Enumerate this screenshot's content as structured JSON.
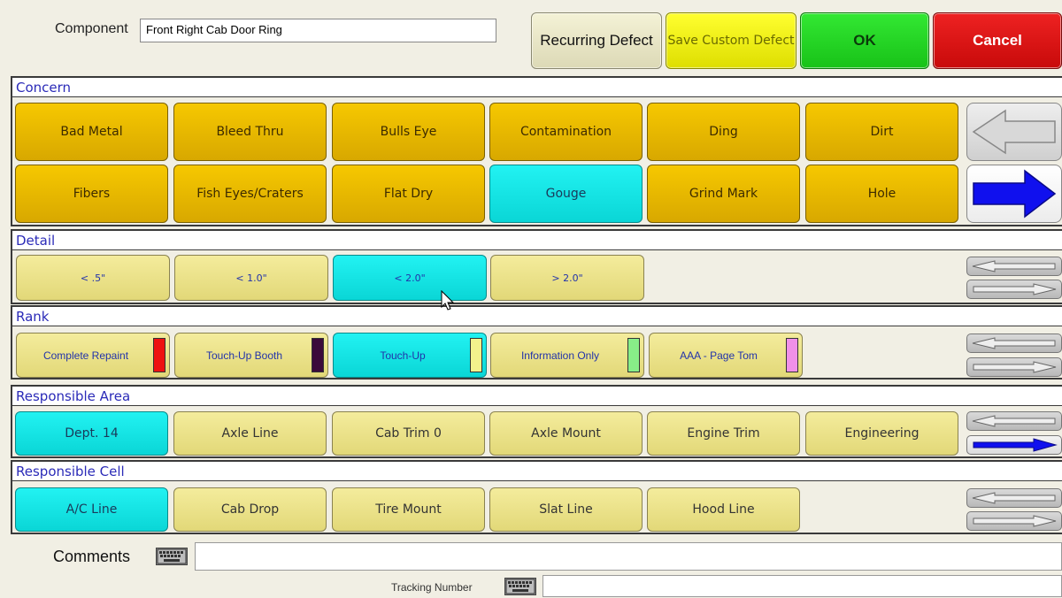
{
  "header": {
    "component_label": "Component",
    "component_value": "Front Right Cab Door Ring",
    "recurring_label": "Recurring Defect",
    "save_custom_label": "Save Custom Defect",
    "ok_label": "OK",
    "cancel_label": "Cancel"
  },
  "concern": {
    "title": "Concern",
    "options": [
      "Bad Metal",
      "Bleed Thru",
      "Bulls Eye",
      "Contamination",
      "Ding",
      "Dirt",
      "Fibers",
      "Fish Eyes/Craters",
      "Flat Dry",
      "Gouge",
      "Grind Mark",
      "Hole"
    ],
    "selected": "Gouge"
  },
  "detail": {
    "title": "Detail",
    "options": [
      "< .5\"",
      "< 1.0\"",
      "< 2.0\"",
      "> 2.0\""
    ],
    "selected": "< 2.0\""
  },
  "rank": {
    "title": "Rank",
    "options": [
      {
        "label": "Complete Repaint",
        "color": "#ee1111"
      },
      {
        "label": "Touch-Up Booth",
        "color": "#3b0a3b"
      },
      {
        "label": "Touch-Up",
        "color": "#f2f28c"
      },
      {
        "label": "Information Only",
        "color": "#88ee88"
      },
      {
        "label": "AAA - Page Tom",
        "color": "#f090e8"
      }
    ],
    "selected": "Touch-Up"
  },
  "responsible_area": {
    "title": "Responsible Area",
    "options": [
      "Dept. 14",
      "Axle Line",
      "Cab Trim 0",
      "Axle Mount",
      "Engine Trim",
      "Engineering"
    ],
    "selected": "Dept. 14"
  },
  "responsible_cell": {
    "title": "Responsible Cell",
    "options": [
      "A/C Line",
      "Cab Drop",
      "Tire Mount",
      "Slat Line",
      "Hood Line"
    ],
    "selected": "A/C Line"
  },
  "footer": {
    "comments_label": "Comments",
    "tracking_label": "Tracking Number"
  },
  "icons": {
    "left_arrow": "arrow-left-icon",
    "right_arrow": "arrow-right-icon",
    "keyboard": "keyboard-icon"
  },
  "colors": {
    "selected": "#00e8e8",
    "gold": "#f0c000",
    "pale": "#eee48c",
    "ok": "#22d022",
    "cancel": "#dd1111",
    "save": "#f0f000",
    "header_text": "#2b2bb8"
  }
}
